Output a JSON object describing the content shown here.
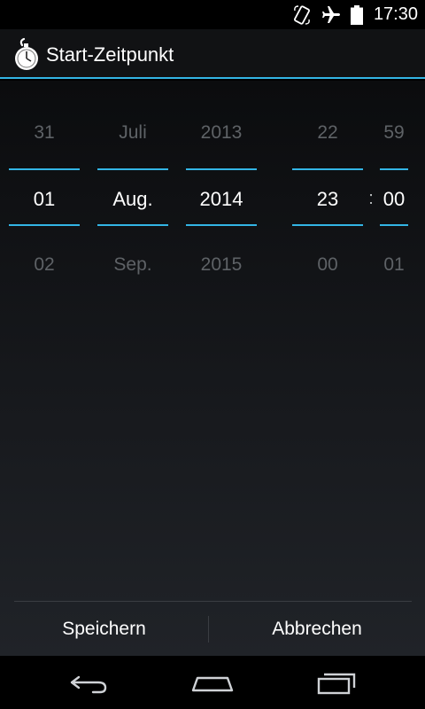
{
  "status_bar": {
    "time": "17:30",
    "icons": [
      "rotation-icon",
      "airplane-mode-icon",
      "battery-icon"
    ]
  },
  "action_bar": {
    "app_icon": "stopwatch-icon",
    "title": "Start-Zeitpunkt"
  },
  "pickers": {
    "day": {
      "prev": "31",
      "current": "01",
      "next": "02"
    },
    "month": {
      "prev": "Juli",
      "current": "Aug.",
      "next": "Sep."
    },
    "year": {
      "prev": "2013",
      "current": "2014",
      "next": "2015"
    },
    "hour": {
      "prev": "22",
      "current": "23",
      "next": "00"
    },
    "minute": {
      "prev": "59",
      "current": "00",
      "next": "01"
    },
    "time_separator": ":"
  },
  "buttons": {
    "save_label": "Speichern",
    "cancel_label": "Abbrechen"
  },
  "nav_bar": {
    "icons": [
      "back-icon",
      "home-icon",
      "recent-apps-icon"
    ]
  },
  "colors": {
    "accent": "#33b5e5",
    "inactive_text": "#5e6266",
    "text": "#ffffff"
  }
}
